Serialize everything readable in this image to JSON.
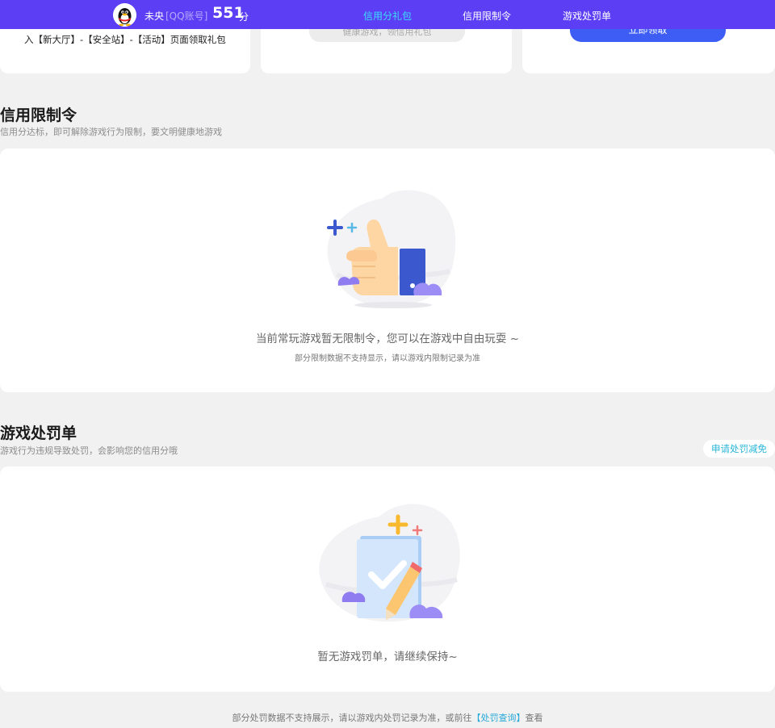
{
  "header": {
    "user_name": "未央",
    "account_type": "[QQ账号]",
    "score": "551",
    "score_unit": "分",
    "tabs": [
      {
        "label": "信用分礼包",
        "active": true
      },
      {
        "label": "信用限制令",
        "active": false
      },
      {
        "label": "游戏处罚单",
        "active": false
      }
    ]
  },
  "gift_cards": {
    "card1_text": "入【新大厅】-【安全站】-【活动】页面领取礼包",
    "card2_button": "健康游戏，领信用礼包",
    "card3_button": "立即领取"
  },
  "restriction": {
    "title": "信用限制令",
    "subtitle": "信用分达标，即可解除游戏行为限制，要文明健康地游戏",
    "empty_main": "当前常玩游戏暂无限制令，您可以在游戏中自由玩耍 ~",
    "empty_sub": "部分限制数据不支持显示，请以游戏内限制记录为准"
  },
  "penalty": {
    "title": "游戏处罚单",
    "subtitle": "游戏行为违规导致处罚，会影响您的信用分哦",
    "apply_button": "申请处罚减免",
    "empty_main": "暂无游戏罚单，请继续保持~"
  },
  "footer": {
    "prefix": "部分处罚数据不支持展示，请以游戏内处罚记录为准，或前往",
    "link": "【处罚查询】",
    "suffix": "查看"
  },
  "colors": {
    "nav_bg": "#5c3ef5",
    "nav_active": "#39e0ff",
    "primary_button": "#3d5df5",
    "link": "#29a9d8"
  }
}
